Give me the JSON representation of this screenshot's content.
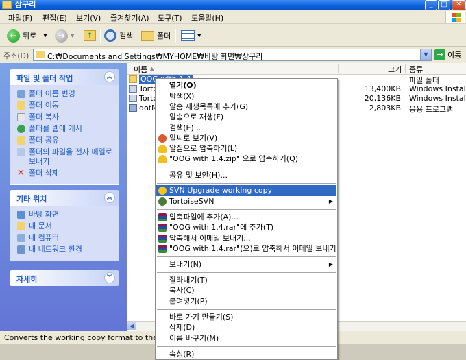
{
  "window": {
    "title": "상구리"
  },
  "menubar": [
    "파일(F)",
    "편집(E)",
    "보기(V)",
    "즐겨찾기(A)",
    "도구(T)",
    "도움말(H)"
  ],
  "toolbar": {
    "back": "뒤로",
    "search": "검색",
    "folders": "폴더"
  },
  "address": {
    "label": "주소(D)",
    "path": "C:₩Documents and Settings₩MYHOME₩바탕 화면₩상구리",
    "go": "이동"
  },
  "left_panels": [
    {
      "title": "파일 및 폴더 작업",
      "items": [
        "폴더 이름 변경",
        "폴더 이동",
        "폴더 복사",
        "폴더를 웹에 게시",
        "폴더 공유",
        "폴더의 파일을 전자 메일로 보내기",
        "폴더 삭제"
      ]
    },
    {
      "title": "기타 위치",
      "items": [
        "바탕 화면",
        "내 문서",
        "내 컴퓨터",
        "내 네트워크 환경"
      ]
    },
    {
      "title": "자세히",
      "items": []
    }
  ],
  "columns": {
    "name": "이름",
    "size": "크기",
    "type": "종류"
  },
  "files": [
    {
      "name": "OOG with 1.4",
      "size": "",
      "type": "파일 폴더"
    },
    {
      "name": "Torto",
      "size": "13,400KB",
      "type": "Windows Installe..."
    },
    {
      "name": "Torto",
      "size": "20,136KB",
      "type": "Windows Installe..."
    },
    {
      "name": "dotNe",
      "size": "2,803KB",
      "type": "응용 프로그램"
    }
  ],
  "status": {
    "text": "Converts the working copy format to the new"
  },
  "context_menu": [
    {
      "label": "열기(O)",
      "bold": true
    },
    {
      "label": "탐색(X)"
    },
    {
      "label": "알송 재생목록에 추가(G)"
    },
    {
      "label": "알송으로 재생(F)"
    },
    {
      "label": "검색(E)..."
    },
    {
      "label": "알씨로 보기(V)",
      "icon": "alsee-icon"
    },
    {
      "label": "알집으로 압축하기(L)",
      "icon": "alzip-icon"
    },
    {
      "label": "\"OOG with 1.4.zip\" 으로 압축하기(Q)",
      "icon": "alzip-icon"
    },
    {
      "sep": true
    },
    {
      "label": "공유 및 보안(H)..."
    },
    {
      "sep": true
    },
    {
      "label": "SVN Upgrade working copy",
      "icon": "svn-upgrade-icon",
      "highlight": true
    },
    {
      "label": "TortoiseSVN",
      "icon": "tortoise-icon",
      "submenu": true
    },
    {
      "sep": true
    },
    {
      "label": "압축파일에 추가(A)...",
      "icon": "winrar-icon"
    },
    {
      "label": "\"OOG with 1.4.rar\"에 추가(T)",
      "icon": "winrar-icon"
    },
    {
      "label": "압축해서 이메일 보내기...",
      "icon": "winrar-icon"
    },
    {
      "label": "\"OOG with 1.4.rar\"(으)로 압축해서 이메일 보내기",
      "icon": "winrar-icon"
    },
    {
      "sep": true
    },
    {
      "label": "보내기(N)",
      "submenu": true
    },
    {
      "sep": true
    },
    {
      "label": "잘라내기(T)"
    },
    {
      "label": "복사(C)"
    },
    {
      "label": "붙여넣기(P)"
    },
    {
      "sep": true
    },
    {
      "label": "바로 가기 만들기(S)"
    },
    {
      "label": "삭제(D)"
    },
    {
      "label": "이름 바꾸기(M)"
    },
    {
      "sep": true
    },
    {
      "label": "속성(R)"
    }
  ]
}
